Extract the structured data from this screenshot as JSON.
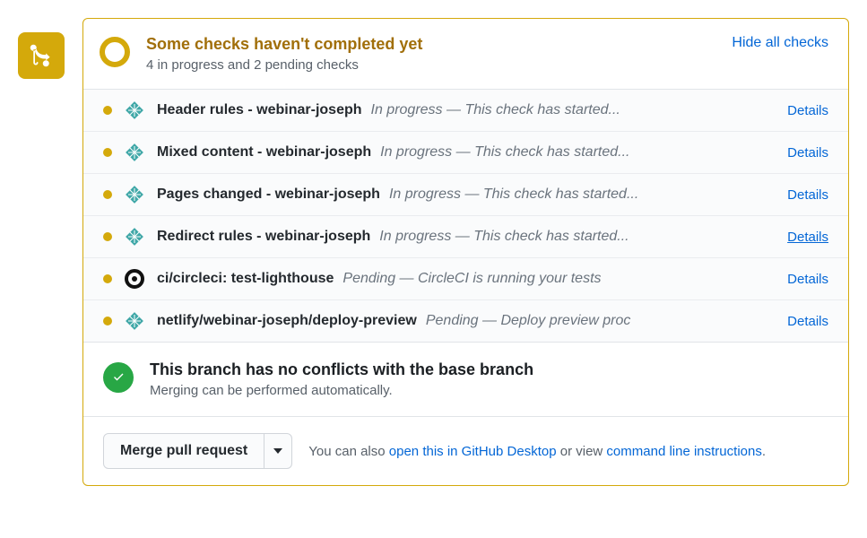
{
  "status": {
    "title": "Some checks haven't completed yet",
    "subtitle": "4 in progress and 2 pending checks",
    "hide_label": "Hide all checks"
  },
  "checks": [
    {
      "icon": "netlify",
      "name": "Header rules - webinar-joseph",
      "status": "In progress — This check has started...",
      "details": "Details",
      "underline": false
    },
    {
      "icon": "netlify",
      "name": "Mixed content - webinar-joseph",
      "status": "In progress — This check has started...",
      "details": "Details",
      "underline": false
    },
    {
      "icon": "netlify",
      "name": "Pages changed - webinar-joseph",
      "status": "In progress — This check has started...",
      "details": "Details",
      "underline": false
    },
    {
      "icon": "netlify",
      "name": "Redirect rules - webinar-joseph",
      "status": "In progress — This check has started...",
      "details": "Details",
      "underline": true
    },
    {
      "icon": "circleci",
      "name": "ci/circleci: test-lighthouse",
      "status": "Pending — CircleCI is running your tests",
      "details": "Details",
      "underline": false
    },
    {
      "icon": "netlify",
      "name": "netlify/webinar-joseph/deploy-preview",
      "status": "Pending — Deploy preview proc",
      "details": "Details",
      "underline": false
    }
  ],
  "conflicts": {
    "title": "This branch has no conflicts with the base branch",
    "subtitle": "Merging can be performed automatically."
  },
  "merge": {
    "button": "Merge pull request",
    "help_prefix": "You can also ",
    "desktop_link": "open this in GitHub Desktop",
    "help_mid": " or view ",
    "cli_link": "command line instructions",
    "help_suffix": "."
  },
  "icons": {
    "netlify": "netlify",
    "circleci": "circleci"
  }
}
